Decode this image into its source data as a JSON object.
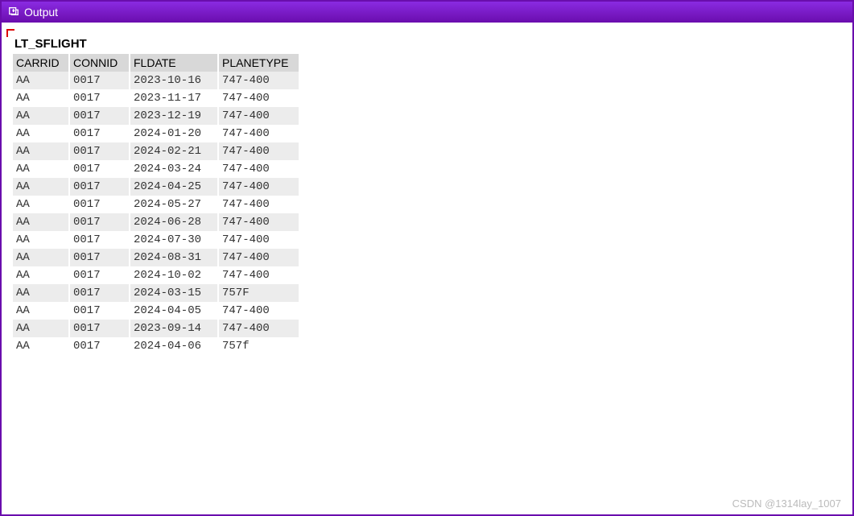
{
  "window": {
    "title": "Output"
  },
  "table": {
    "title": "LT_SFLIGHT",
    "columns": [
      "CARRID",
      "CONNID",
      "FLDATE",
      "PLANETYPE"
    ],
    "rows": [
      {
        "carrid": "AA",
        "connid": "0017",
        "fldate": "2023-10-16",
        "planetype": "747-400"
      },
      {
        "carrid": "AA",
        "connid": "0017",
        "fldate": "2023-11-17",
        "planetype": "747-400"
      },
      {
        "carrid": "AA",
        "connid": "0017",
        "fldate": "2023-12-19",
        "planetype": "747-400"
      },
      {
        "carrid": "AA",
        "connid": "0017",
        "fldate": "2024-01-20",
        "planetype": "747-400"
      },
      {
        "carrid": "AA",
        "connid": "0017",
        "fldate": "2024-02-21",
        "planetype": "747-400"
      },
      {
        "carrid": "AA",
        "connid": "0017",
        "fldate": "2024-03-24",
        "planetype": "747-400"
      },
      {
        "carrid": "AA",
        "connid": "0017",
        "fldate": "2024-04-25",
        "planetype": "747-400"
      },
      {
        "carrid": "AA",
        "connid": "0017",
        "fldate": "2024-05-27",
        "planetype": "747-400"
      },
      {
        "carrid": "AA",
        "connid": "0017",
        "fldate": "2024-06-28",
        "planetype": "747-400"
      },
      {
        "carrid": "AA",
        "connid": "0017",
        "fldate": "2024-07-30",
        "planetype": "747-400"
      },
      {
        "carrid": "AA",
        "connid": "0017",
        "fldate": "2024-08-31",
        "planetype": "747-400"
      },
      {
        "carrid": "AA",
        "connid": "0017",
        "fldate": "2024-10-02",
        "planetype": "747-400"
      },
      {
        "carrid": "AA",
        "connid": "0017",
        "fldate": "2024-03-15",
        "planetype": "757F"
      },
      {
        "carrid": "AA",
        "connid": "0017",
        "fldate": "2024-04-05",
        "planetype": "747-400"
      },
      {
        "carrid": "AA",
        "connid": "0017",
        "fldate": "2023-09-14",
        "planetype": "747-400"
      },
      {
        "carrid": "AA",
        "connid": "0017",
        "fldate": "2024-04-06",
        "planetype": "757f"
      }
    ]
  },
  "watermark": "CSDN @1314lay_1007"
}
